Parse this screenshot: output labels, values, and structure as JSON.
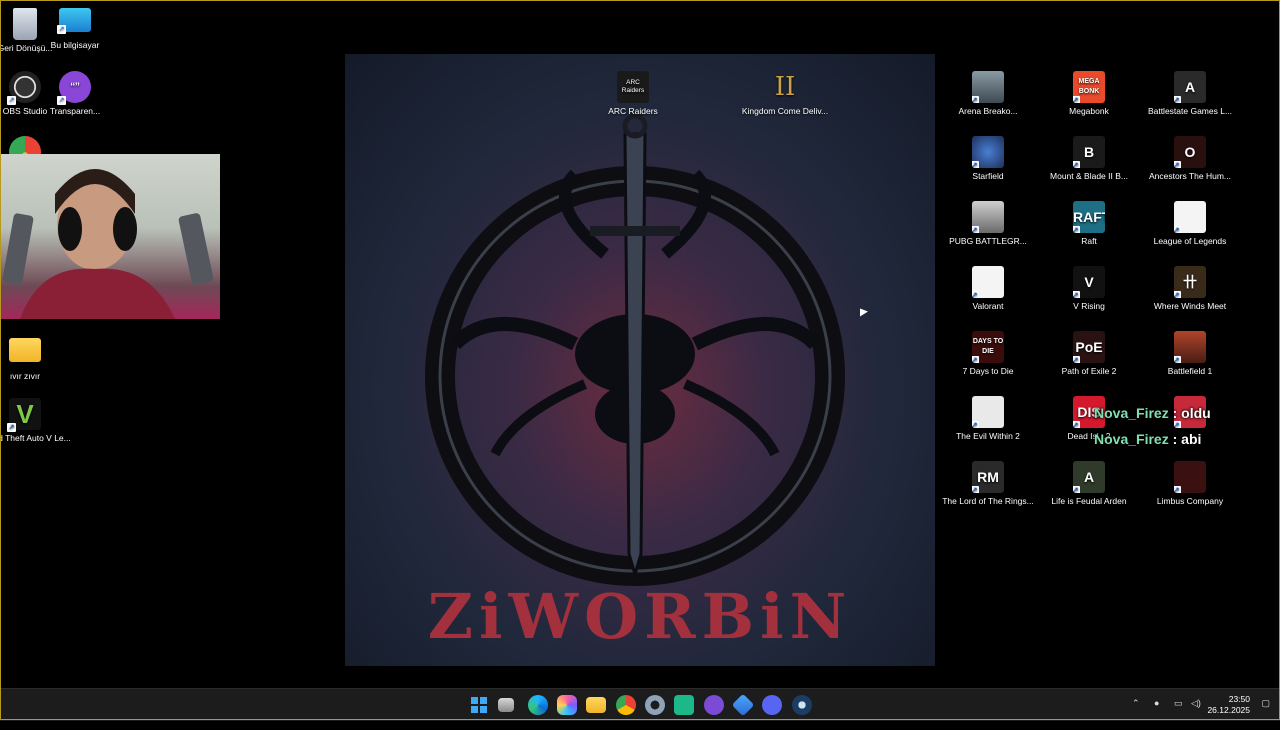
{
  "desktop": {
    "left_icons": [
      {
        "label": "Geri Dönüşü...",
        "icon": "recycle-bin-icon"
      },
      {
        "label": "Bu bilgisayar",
        "icon": "this-pc-icon"
      },
      {
        "label": "OBS Studio",
        "icon": "obs-icon"
      },
      {
        "label": "Transparen...",
        "icon": "chat-bubble-icon"
      },
      {
        "label": "ıvır zıvır",
        "icon": "folder-icon"
      },
      {
        "label": "Grand Theft Auto V Le...",
        "icon": "gta-v-icon"
      }
    ],
    "center_icons": [
      {
        "label": "ARC Raiders",
        "icon": "arc-raiders-icon",
        "badge": "ARC Raiders"
      },
      {
        "label": "Kingdom Come Deliv...",
        "icon": "kingdom-come-icon",
        "badge": "II"
      }
    ],
    "right_icons": [
      {
        "label": "Arena Breako...",
        "icon": "arena-breakout-icon",
        "badge": ""
      },
      {
        "label": "Megabonk",
        "icon": "megabonk-icon",
        "badge": "MEGA BONK"
      },
      {
        "label": "Battlestate Games L...",
        "icon": "battlestate-icon",
        "badge": "A"
      },
      {
        "label": "Starfield",
        "icon": "starfield-icon",
        "badge": ""
      },
      {
        "label": "Mount & Blade II B...",
        "icon": "mount-blade-icon",
        "badge": "B"
      },
      {
        "label": "Ancestors The Hum...",
        "icon": "ancestors-icon",
        "badge": "O"
      },
      {
        "label": "PUBG BATTLEGR...",
        "icon": "pubg-icon",
        "badge": ""
      },
      {
        "label": "Raft",
        "icon": "raft-icon",
        "badge": "RAFT"
      },
      {
        "label": "League of Legends",
        "icon": "file-icon",
        "badge": ""
      },
      {
        "label": "Valorant",
        "icon": "file-icon",
        "badge": ""
      },
      {
        "label": "V Rising",
        "icon": "v-rising-icon",
        "badge": "V"
      },
      {
        "label": "Where Winds Meet",
        "icon": "where-winds-icon",
        "badge": "卄"
      },
      {
        "label": "7 Days to Die",
        "icon": "seven-days-icon",
        "badge": "DAYS TO DIE"
      },
      {
        "label": "Path of Exile 2",
        "icon": "poe-icon",
        "badge": "PoE"
      },
      {
        "label": "Battlefield 1",
        "icon": "battlefield-icon",
        "badge": ""
      },
      {
        "label": "The Evil Within 2",
        "icon": "evil-within-icon",
        "badge": ""
      },
      {
        "label": "Dead Isl...2",
        "icon": "dead-island-icon",
        "badge": "DIS"
      },
      {
        "label": "",
        "icon": "red-icon",
        "badge": ""
      },
      {
        "label": "The Lord of The Rings...",
        "icon": "lotr-icon",
        "badge": "RM"
      },
      {
        "label": "Life is Feudal Arden",
        "icon": "life-is-feudal-icon",
        "badge": "A"
      },
      {
        "label": "Limbus Company",
        "icon": "limbus-icon",
        "badge": ""
      }
    ]
  },
  "wallpaper": {
    "title": "ZiWORBiN"
  },
  "chat": [
    {
      "user": "Nova_Firez",
      "sep": ":",
      "message": "oldu"
    },
    {
      "user": "Nova_Firez",
      "sep": ":",
      "message": "abi"
    }
  ],
  "taskbar": {
    "apps": [
      "start-icon",
      "task-view-icon",
      "edge-icon",
      "copilot-icon",
      "file-explorer-icon",
      "chrome-icon",
      "settings-icon",
      "app-icon",
      "twitch-icon",
      "network-app-icon",
      "discord-icon",
      "steam-icon"
    ],
    "time": "23:50",
    "date": "26.12.2025"
  },
  "colors": {
    "accent": "#b79a1d",
    "chat_user": "#7fe0b0",
    "wallpaper_title": "#a3303d"
  }
}
